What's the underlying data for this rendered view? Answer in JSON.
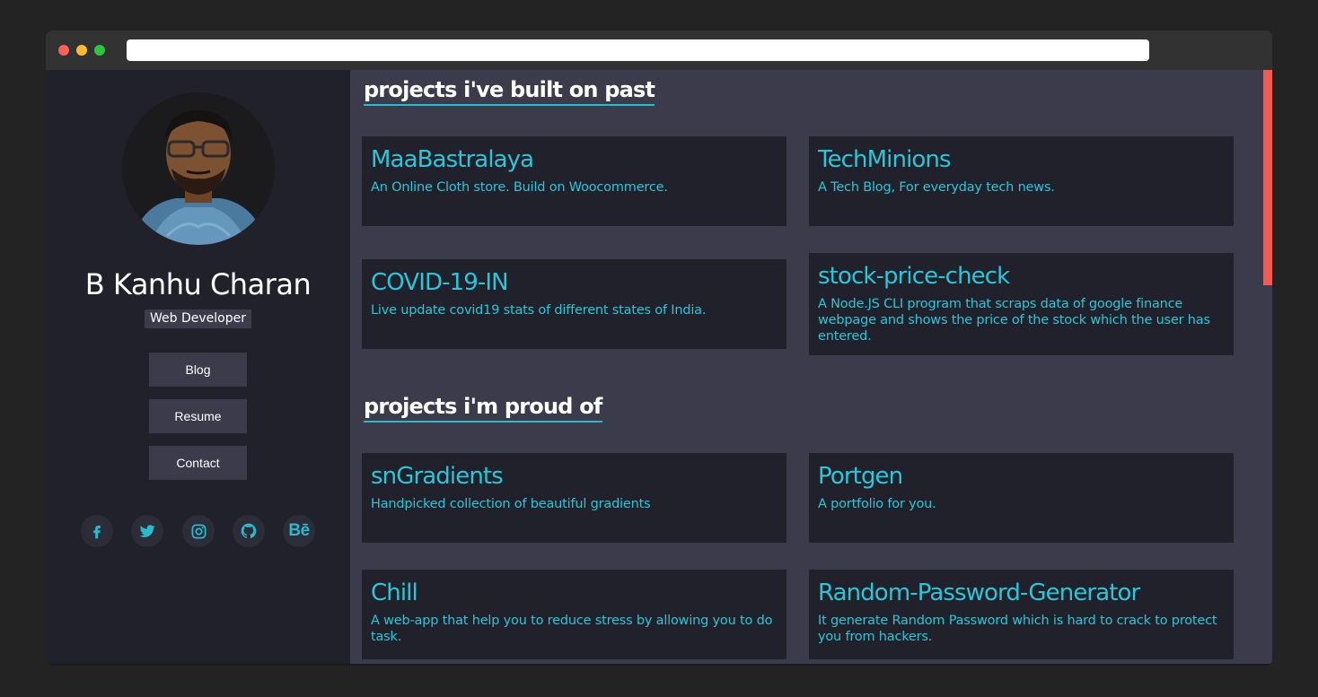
{
  "browser": {
    "address_value": "",
    "controls": [
      "close-dot",
      "minimize-dot",
      "maximize-dot"
    ]
  },
  "profile": {
    "name": "B Kanhu Charan",
    "role": "Web Developer",
    "avatar_icon": "user-photo"
  },
  "nav": {
    "blog": "Blog",
    "resume": "Resume",
    "contact": "Contact"
  },
  "social": {
    "facebook_icon": "facebook-icon",
    "twitter_icon": "twitter-icon",
    "instagram_icon": "instagram-icon",
    "github_icon": "github-icon",
    "behance_text": "Bē"
  },
  "sections": {
    "past": {
      "title": "projects i've built on past",
      "projects": [
        {
          "title": "MaaBastralaya",
          "desc": "An Online Cloth store. Build on Woocommerce."
        },
        {
          "title": "TechMinions",
          "desc": "A Tech Blog, For everyday tech news."
        },
        {
          "title": "COVID-19-IN",
          "desc": "Live update covid19 stats of different states of India."
        },
        {
          "title": "stock-price-check",
          "desc": "A Node.JS CLI program that scraps data of google finance webpage and shows the price of the stock which the user has entered."
        }
      ]
    },
    "proud": {
      "title": "projects i'm proud of",
      "projects": [
        {
          "title": "snGradients",
          "desc": "Handpicked collection of beautiful gradients"
        },
        {
          "title": "Portgen",
          "desc": "A portfolio for you."
        },
        {
          "title": "Chill",
          "desc": "A web-app that help you to reduce stress by allowing you to do task."
        },
        {
          "title": "Random-Password-Generator",
          "desc": "It generate Random Password which is hard to crack to protect you from hackers."
        }
      ]
    }
  },
  "colors": {
    "accent": "#2bc6d8",
    "scrollbar_thumb": "#f45a52",
    "sidebar_bg": "#21212c",
    "main_bg": "#3c3b4c"
  }
}
